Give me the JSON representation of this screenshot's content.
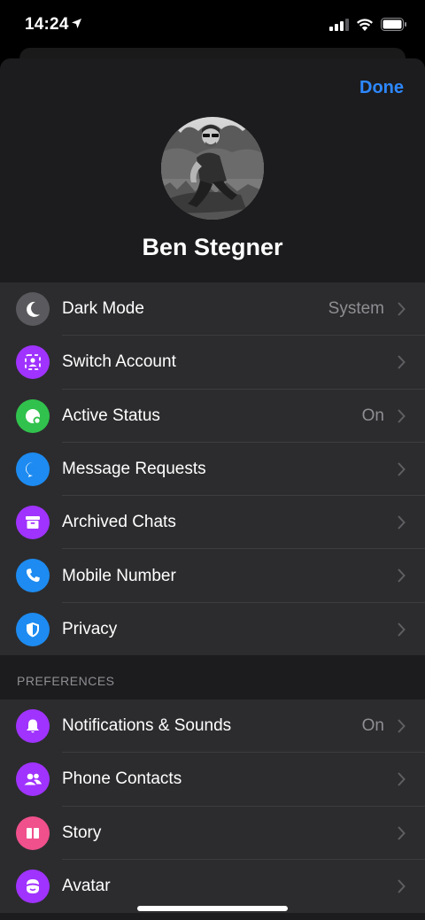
{
  "status_bar": {
    "time": "14:24"
  },
  "header": {
    "done_label": "Done"
  },
  "profile": {
    "name": "Ben Stegner"
  },
  "account_items": [
    {
      "label": "Dark Mode",
      "value": "System",
      "icon": "moon-icon",
      "color": "#5a5a5e"
    },
    {
      "label": "Switch Account",
      "value": "",
      "icon": "switch-account-icon",
      "color": "#a033ff"
    },
    {
      "label": "Active Status",
      "value": "On",
      "icon": "active-status-icon",
      "color": "#31c24d"
    },
    {
      "label": "Message Requests",
      "value": "",
      "icon": "chat-bubble-icon",
      "color": "#1d8bf1"
    },
    {
      "label": "Archived Chats",
      "value": "",
      "icon": "archive-box-icon",
      "color": "#a033ff"
    },
    {
      "label": "Mobile Number",
      "value": "",
      "icon": "phone-icon",
      "color": "#1d8bf1"
    },
    {
      "label": "Privacy",
      "value": "",
      "icon": "shield-icon",
      "color": "#1d8bf1"
    }
  ],
  "preferences": {
    "header": "PREFERENCES",
    "items": [
      {
        "label": "Notifications & Sounds",
        "value": "On",
        "icon": "bell-icon",
        "color": "#a033ff"
      },
      {
        "label": "Phone Contacts",
        "value": "",
        "icon": "contacts-icon",
        "color": "#a033ff"
      },
      {
        "label": "Story",
        "value": "",
        "icon": "story-icon",
        "color": "#f0508c"
      },
      {
        "label": "Avatar",
        "value": "",
        "icon": "avatar-face-icon",
        "color": "#a033ff"
      }
    ]
  }
}
